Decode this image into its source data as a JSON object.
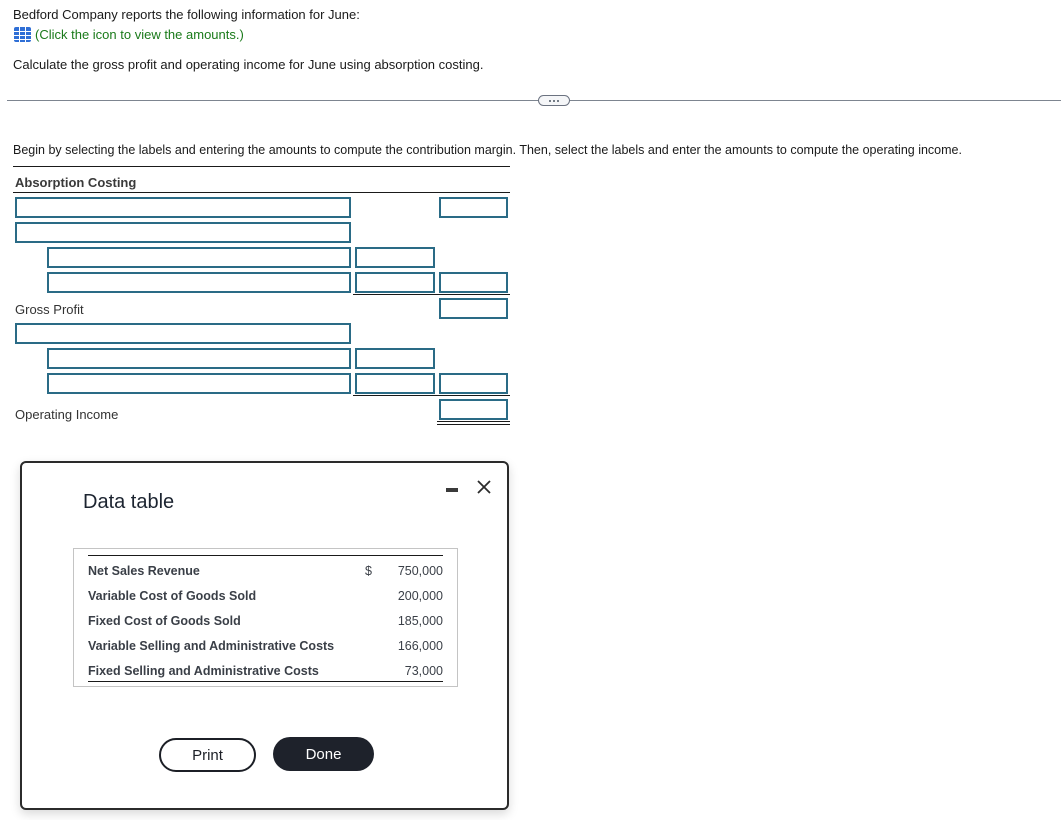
{
  "problem": {
    "intro": "Bedford Company reports the following information for June:",
    "hint_icon": "table-grid-icon",
    "hint_text": "(Click the icon to view the amounts.)",
    "question": "Calculate the gross profit and operating income for June using absorption costing.",
    "more_button_icon": "ellipsis-icon"
  },
  "worksheet": {
    "instructions": "Begin by selecting the labels and entering the amounts to compute the contribution margin. Then, select the labels and enter the amounts to compute the operating income.",
    "title": "Absorption Costing",
    "gross_profit_label": "Gross Profit",
    "operating_income_label": "Operating Income",
    "inputs": {
      "label_1": "",
      "amount_1": "",
      "label_2": "",
      "label_3": "",
      "sub_3": "",
      "label_4": "",
      "sub_4": "",
      "amount_4": "",
      "gross_profit_amount": "",
      "label_5": "",
      "label_6": "",
      "sub_6": "",
      "label_7": "",
      "sub_7": "",
      "amount_7": "",
      "operating_income_amount": ""
    }
  },
  "modal": {
    "title": "Data table",
    "minimize_icon": "minimize-icon",
    "close_icon": "close-icon",
    "rows": [
      {
        "label": "Net Sales Revenue",
        "currency": "$",
        "value": "750,000"
      },
      {
        "label": "Variable Cost of Goods Sold",
        "currency": "",
        "value": "200,000"
      },
      {
        "label": "Fixed Cost of Goods Sold",
        "currency": "",
        "value": "185,000"
      },
      {
        "label": "Variable Selling and Administrative Costs",
        "currency": "",
        "value": "166,000"
      },
      {
        "label": "Fixed Selling and Administrative Costs",
        "currency": "",
        "value": "73,000"
      }
    ],
    "print_label": "Print",
    "done_label": "Done"
  },
  "colors": {
    "input_border": "#2a6b86",
    "hint_green": "#1a7a1a",
    "icon_blue": "#2f6fd6",
    "done_button_bg": "#1e222b"
  }
}
